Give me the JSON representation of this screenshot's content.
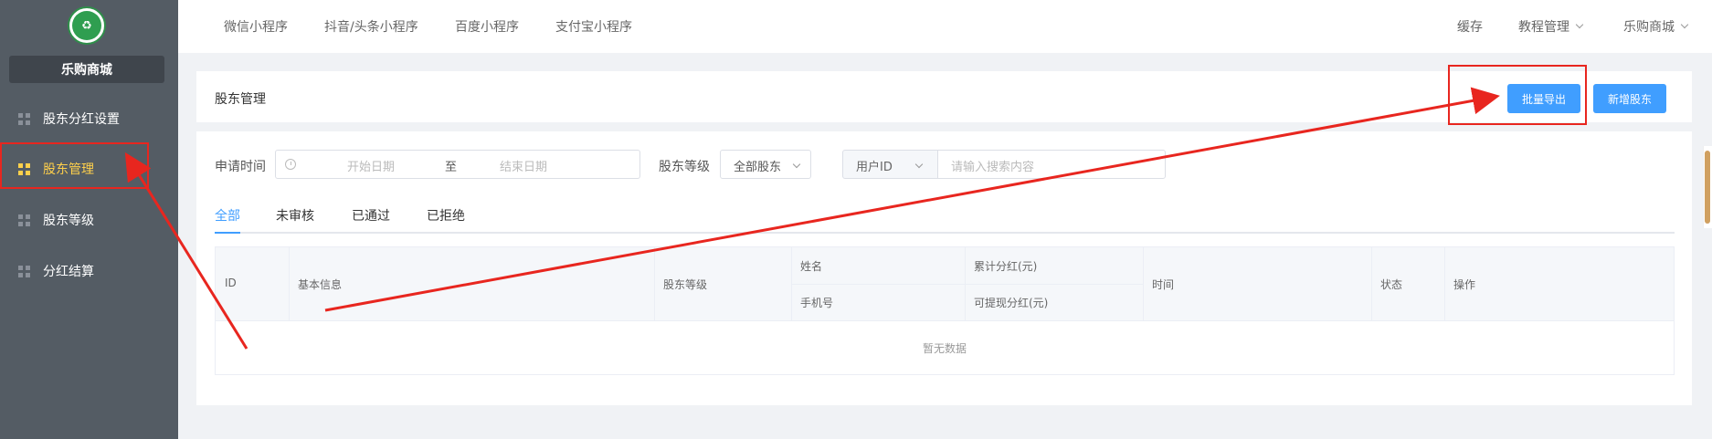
{
  "sidebar": {
    "logo_icon": "shop-logo-icon",
    "shop_name": "乐购商城",
    "items": [
      {
        "label": "股东分红设置",
        "icon": "grid-icon"
      },
      {
        "label": "股东管理",
        "icon": "grid-icon",
        "active": true
      },
      {
        "label": "股东等级",
        "icon": "grid-icon"
      },
      {
        "label": "分红结算",
        "icon": "grid-icon"
      }
    ]
  },
  "topbar": {
    "nav": [
      "微信小程序",
      "抖音/头条小程序",
      "百度小程序",
      "支付宝小程序"
    ],
    "right": {
      "cache": "缓存",
      "tutorial": "教程管理",
      "shop": "乐购商城"
    }
  },
  "header": {
    "title": "股东管理",
    "export_label": "批量导出",
    "add_label": "新增股东"
  },
  "filters": {
    "apply_time_label": "申请时间",
    "start_placeholder": "开始日期",
    "range_separator": "至",
    "end_placeholder": "结束日期",
    "level_label": "股东等级",
    "level_value": "全部股东",
    "field_value": "用户ID",
    "search_placeholder": "请输入搜索内容"
  },
  "tabs": [
    "全部",
    "未审核",
    "已通过",
    "已拒绝"
  ],
  "table": {
    "columns": {
      "id": "ID",
      "info": "基本信息",
      "level": "股东等级",
      "name": "姓名",
      "phone": "手机号",
      "total_dividend": "累计分红(元)",
      "withdrawable": "可提现分红(元)",
      "time": "时间",
      "status": "状态",
      "action": "操作"
    },
    "empty_text": "暂无数据"
  },
  "colors": {
    "sidebar_bg": "#545c64",
    "active": "#ffd04b",
    "primary": "#409eff",
    "annotation": "#e8261f"
  }
}
